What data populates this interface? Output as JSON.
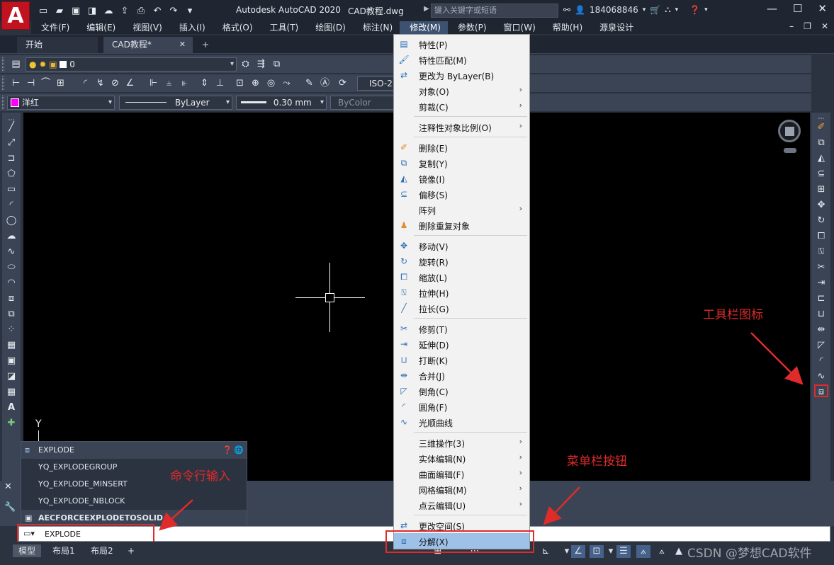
{
  "titlebar": {
    "app_logo": "A",
    "app_title": "Autodesk AutoCAD 2020",
    "doc_name": "CAD教程.dwg",
    "search_placeholder": "键入关键字或短语",
    "user_id": "184068846",
    "quick_access": [
      "new-icon",
      "open-icon",
      "save-icon",
      "saveas-icon",
      "cloud-open-icon",
      "cloud-save-icon",
      "print-icon",
      "undo-icon",
      "redo-icon",
      "dropdown-icon"
    ],
    "window_controls": [
      "minimize-icon",
      "restore-icon",
      "close-icon"
    ]
  },
  "menubar": {
    "items": [
      "文件(F)",
      "编辑(E)",
      "视图(V)",
      "插入(I)",
      "格式(O)",
      "工具(T)",
      "绘图(D)",
      "标注(N)",
      "修改(M)",
      "参数(P)",
      "窗口(W)",
      "帮助(H)",
      "源泉设计"
    ],
    "active": "修改(M)"
  },
  "tabs": {
    "start": "开始",
    "drawing": "CAD教程*",
    "close": "✕",
    "add": "+"
  },
  "toolbars": {
    "layer_value": "0",
    "dim_style": "ISO-2",
    "color_value": "洋红",
    "linetype_value": "ByLayer",
    "lineweight_value": "0.30 mm",
    "plotstyle_value": "ByColor",
    "colors": {
      "magenta": "#ff00ff",
      "layer_swatch": "#ffffff"
    }
  },
  "canvas": {
    "ucs_y_label": "Y"
  },
  "command_popup": {
    "header": "EXPLODE",
    "options": [
      "YQ_EXPLODEGROUP",
      "YQ_EXPLODE_MINSERT",
      "YQ_EXPLODE_NBLOCK"
    ],
    "footer": "AECFORCEEXPLODETOSOLID"
  },
  "command_line": {
    "input_value": "EXPLODE"
  },
  "statusbar": {
    "layouts": [
      "模型",
      "布局1",
      "布局2",
      "+"
    ]
  },
  "modify_menu": {
    "items": [
      {
        "label": "特性(P)",
        "icon": "properties-icon"
      },
      {
        "label": "特性匹配(M)",
        "icon": "match-properties-icon"
      },
      {
        "label": "更改为 ByLayer(B)",
        "icon": "change-bylayer-icon"
      },
      {
        "label": "对象(O)",
        "submenu": true
      },
      {
        "label": "剪裁(C)",
        "submenu": true
      },
      {
        "label": "注释性对象比例(O)",
        "submenu": true
      },
      {
        "label": "删除(E)",
        "icon": "erase-icon"
      },
      {
        "label": "复制(Y)",
        "icon": "copy-icon"
      },
      {
        "label": "镜像(I)",
        "icon": "mirror-icon"
      },
      {
        "label": "偏移(S)",
        "icon": "offset-icon"
      },
      {
        "label": "阵列",
        "submenu": true
      },
      {
        "label": "删除重复对象",
        "icon": "overkill-icon"
      },
      {
        "label": "移动(V)",
        "icon": "move-icon"
      },
      {
        "label": "旋转(R)",
        "icon": "rotate-icon"
      },
      {
        "label": "缩放(L)",
        "icon": "scale-icon"
      },
      {
        "label": "拉伸(H)",
        "icon": "stretch-icon"
      },
      {
        "label": "拉长(G)",
        "icon": "lengthen-icon"
      },
      {
        "label": "修剪(T)",
        "icon": "trim-icon"
      },
      {
        "label": "延伸(D)",
        "icon": "extend-icon"
      },
      {
        "label": "打断(K)",
        "icon": "break-icon"
      },
      {
        "label": "合并(J)",
        "icon": "join-icon"
      },
      {
        "label": "倒角(C)",
        "icon": "chamfer-icon"
      },
      {
        "label": "圆角(F)",
        "icon": "fillet-icon"
      },
      {
        "label": "光顺曲线",
        "icon": "blend-curves-icon"
      },
      {
        "label": "三维操作(3)",
        "submenu": true
      },
      {
        "label": "实体编辑(N)",
        "submenu": true
      },
      {
        "label": "曲面编辑(F)",
        "submenu": true
      },
      {
        "label": "网格编辑(M)",
        "submenu": true
      },
      {
        "label": "点云编辑(U)",
        "submenu": true
      },
      {
        "label": "更改空间(S)",
        "icon": "change-space-icon"
      },
      {
        "label": "分解(X)",
        "icon": "explode-icon",
        "highlighted": true
      }
    ]
  },
  "annotations": {
    "toolbar_icon_label": "工具栏图标",
    "menu_button_label": "菜单栏按钮",
    "command_input_label": "命令行输入",
    "color": "#e02b2b"
  },
  "watermark": "CSDN @梦想CAD软件"
}
